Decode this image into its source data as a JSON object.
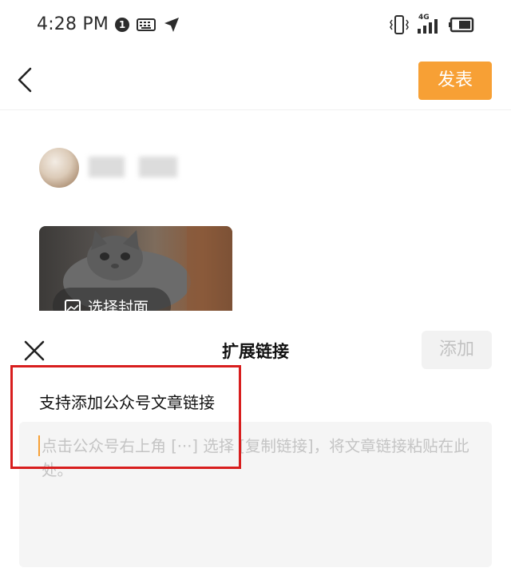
{
  "status_bar": {
    "time": "4:28 PM",
    "notification_count": "1",
    "network_label": "4G",
    "icons": [
      "notification-badge",
      "keyboard-icon",
      "location-arrow-icon",
      "vibrate-icon",
      "signal-icon",
      "battery-icon"
    ]
  },
  "header": {
    "back_icon": "chevron-left-icon",
    "publish_label": "发表",
    "publish_color": "#f7a035"
  },
  "author": {
    "avatar_icon": "avatar",
    "name": ""
  },
  "cover": {
    "choose_cover_label": "选择封面",
    "choose_cover_icon": "image-icon"
  },
  "sheet": {
    "title": "扩展链接",
    "close_icon": "close-icon",
    "add_label": "添加",
    "hint": "支持添加公众号文章链接",
    "input_placeholder": "点击公众号右上角 [···] 选择 [复制链接]，将文章链接粘贴在此处。",
    "input_value": ""
  },
  "colors": {
    "accent": "#f7a035",
    "highlight": "#d81e1e",
    "input_bg": "#f5f5f5"
  }
}
